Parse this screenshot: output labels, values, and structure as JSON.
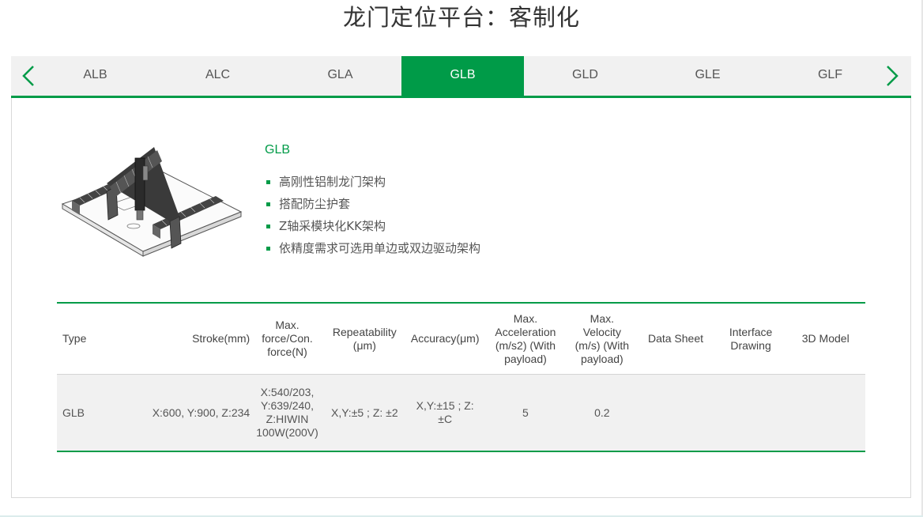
{
  "page": {
    "title": "龙门定位平台：客制化"
  },
  "tabs": {
    "items": [
      {
        "label": "ALB",
        "active": false
      },
      {
        "label": "ALC",
        "active": false
      },
      {
        "label": "GLA",
        "active": false
      },
      {
        "label": "GLB",
        "active": true
      },
      {
        "label": "GLD",
        "active": false
      },
      {
        "label": "GLE",
        "active": false
      },
      {
        "label": "GLF",
        "active": false
      }
    ],
    "prev_icon": "chevron-left-icon",
    "next_icon": "chevron-right-icon",
    "accent_color": "#009b48"
  },
  "product": {
    "name": "GLB",
    "features": [
      "高刚性铝制龙门架构",
      "搭配防尘护套",
      "Z轴采模块化KK架构",
      "依精度需求可选用单边或双边驱动架构"
    ]
  },
  "spec_table": {
    "headers": [
      "Type",
      "Stroke(mm)",
      "Max. force/Con. force(N)",
      "Repeatability (μm)",
      "Accuracy(μm)",
      "Max. Acceleration (m/s2) (With payload)",
      "Max. Velocity (m/s) (With payload)",
      "Data Sheet",
      "Interface Drawing",
      "3D Model"
    ],
    "rows": [
      [
        "GLB",
        "X:600, Y:900, Z:234",
        "X:540/203, Y:639/240, Z:HIWIN 100W(200V)",
        "X,Y:±5 ; Z: ±2",
        "X,Y:±15 ; Z: ±C",
        "5",
        "0.2",
        "",
        "",
        ""
      ]
    ]
  }
}
